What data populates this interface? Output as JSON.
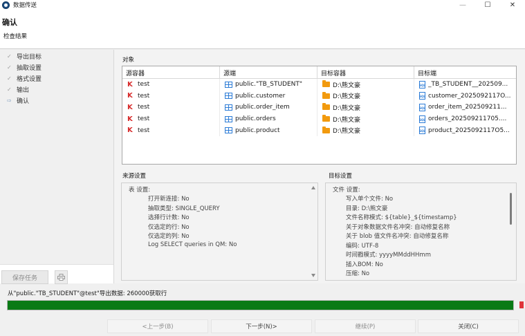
{
  "window": {
    "title": "数据传送"
  },
  "header": {
    "title": "确认",
    "subtitle": "检查结果"
  },
  "nav": {
    "items": [
      {
        "label": "导出目标",
        "state": "done"
      },
      {
        "label": "抽取设置",
        "state": "done"
      },
      {
        "label": "格式设置",
        "state": "done"
      },
      {
        "label": "输出",
        "state": "done"
      },
      {
        "label": "确认",
        "state": "current"
      }
    ],
    "save_label": "保存任务"
  },
  "objects": {
    "label": "对象",
    "columns": [
      "源容器",
      "源端",
      "目标容器",
      "目标端"
    ],
    "rows": [
      {
        "src_container": "test",
        "source": "public.\"TB_STUDENT\"",
        "tgt_container": "D:\\熊文豪",
        "target": "_TB_STUDENT__202509..."
      },
      {
        "src_container": "test",
        "source": "public.customer",
        "tgt_container": "D:\\熊文豪",
        "target": "customer_2025092117O..."
      },
      {
        "src_container": "test",
        "source": "public.order_item",
        "tgt_container": "D:\\熊文豪",
        "target": "order_item_202509211..."
      },
      {
        "src_container": "test",
        "source": "public.orders",
        "tgt_container": "D:\\熊文豪",
        "target": "orders_202509211705...."
      },
      {
        "src_container": "test",
        "source": "public.product",
        "tgt_container": "D:\\熊文豪",
        "target": "product_2025092117O5..."
      }
    ]
  },
  "source_settings": {
    "label": "来源设置",
    "heading": "表 设置:",
    "lines": [
      "打开新连接: No",
      "抽取类型: SINGLE_QUERY",
      "选择行计数: No",
      "仅选定的行: No",
      "仅选定的列: No",
      "Log SELECT queries in QM: No"
    ]
  },
  "target_settings": {
    "label": "目标设置",
    "heading": "文件 设置:",
    "lines": [
      "写入单个文件: No",
      "目录: D:\\熊文豪",
      "文件名称模式: ${table}_${timestamp}",
      "关于对象数据文件名冲突: 自动修复名称",
      "关于 blob 值文件名冲突: 自动修复名称",
      "编码: UTF-8",
      "时间戳模式: yyyyMMddHHmm",
      "插入BOM: No",
      "压缩: No"
    ]
  },
  "status": {
    "text": "从\"public.\"TB_STUDENT\"@test\"导出数据: 260000获取行",
    "progress_fraction": 1.0,
    "progress_color": "#0a7a15",
    "stop_color": "#e0343a"
  },
  "footer": {
    "prev": "<上一步(B)",
    "next": "下一步(N)>",
    "continue": "继续(P)",
    "close": "关闭(C)"
  }
}
